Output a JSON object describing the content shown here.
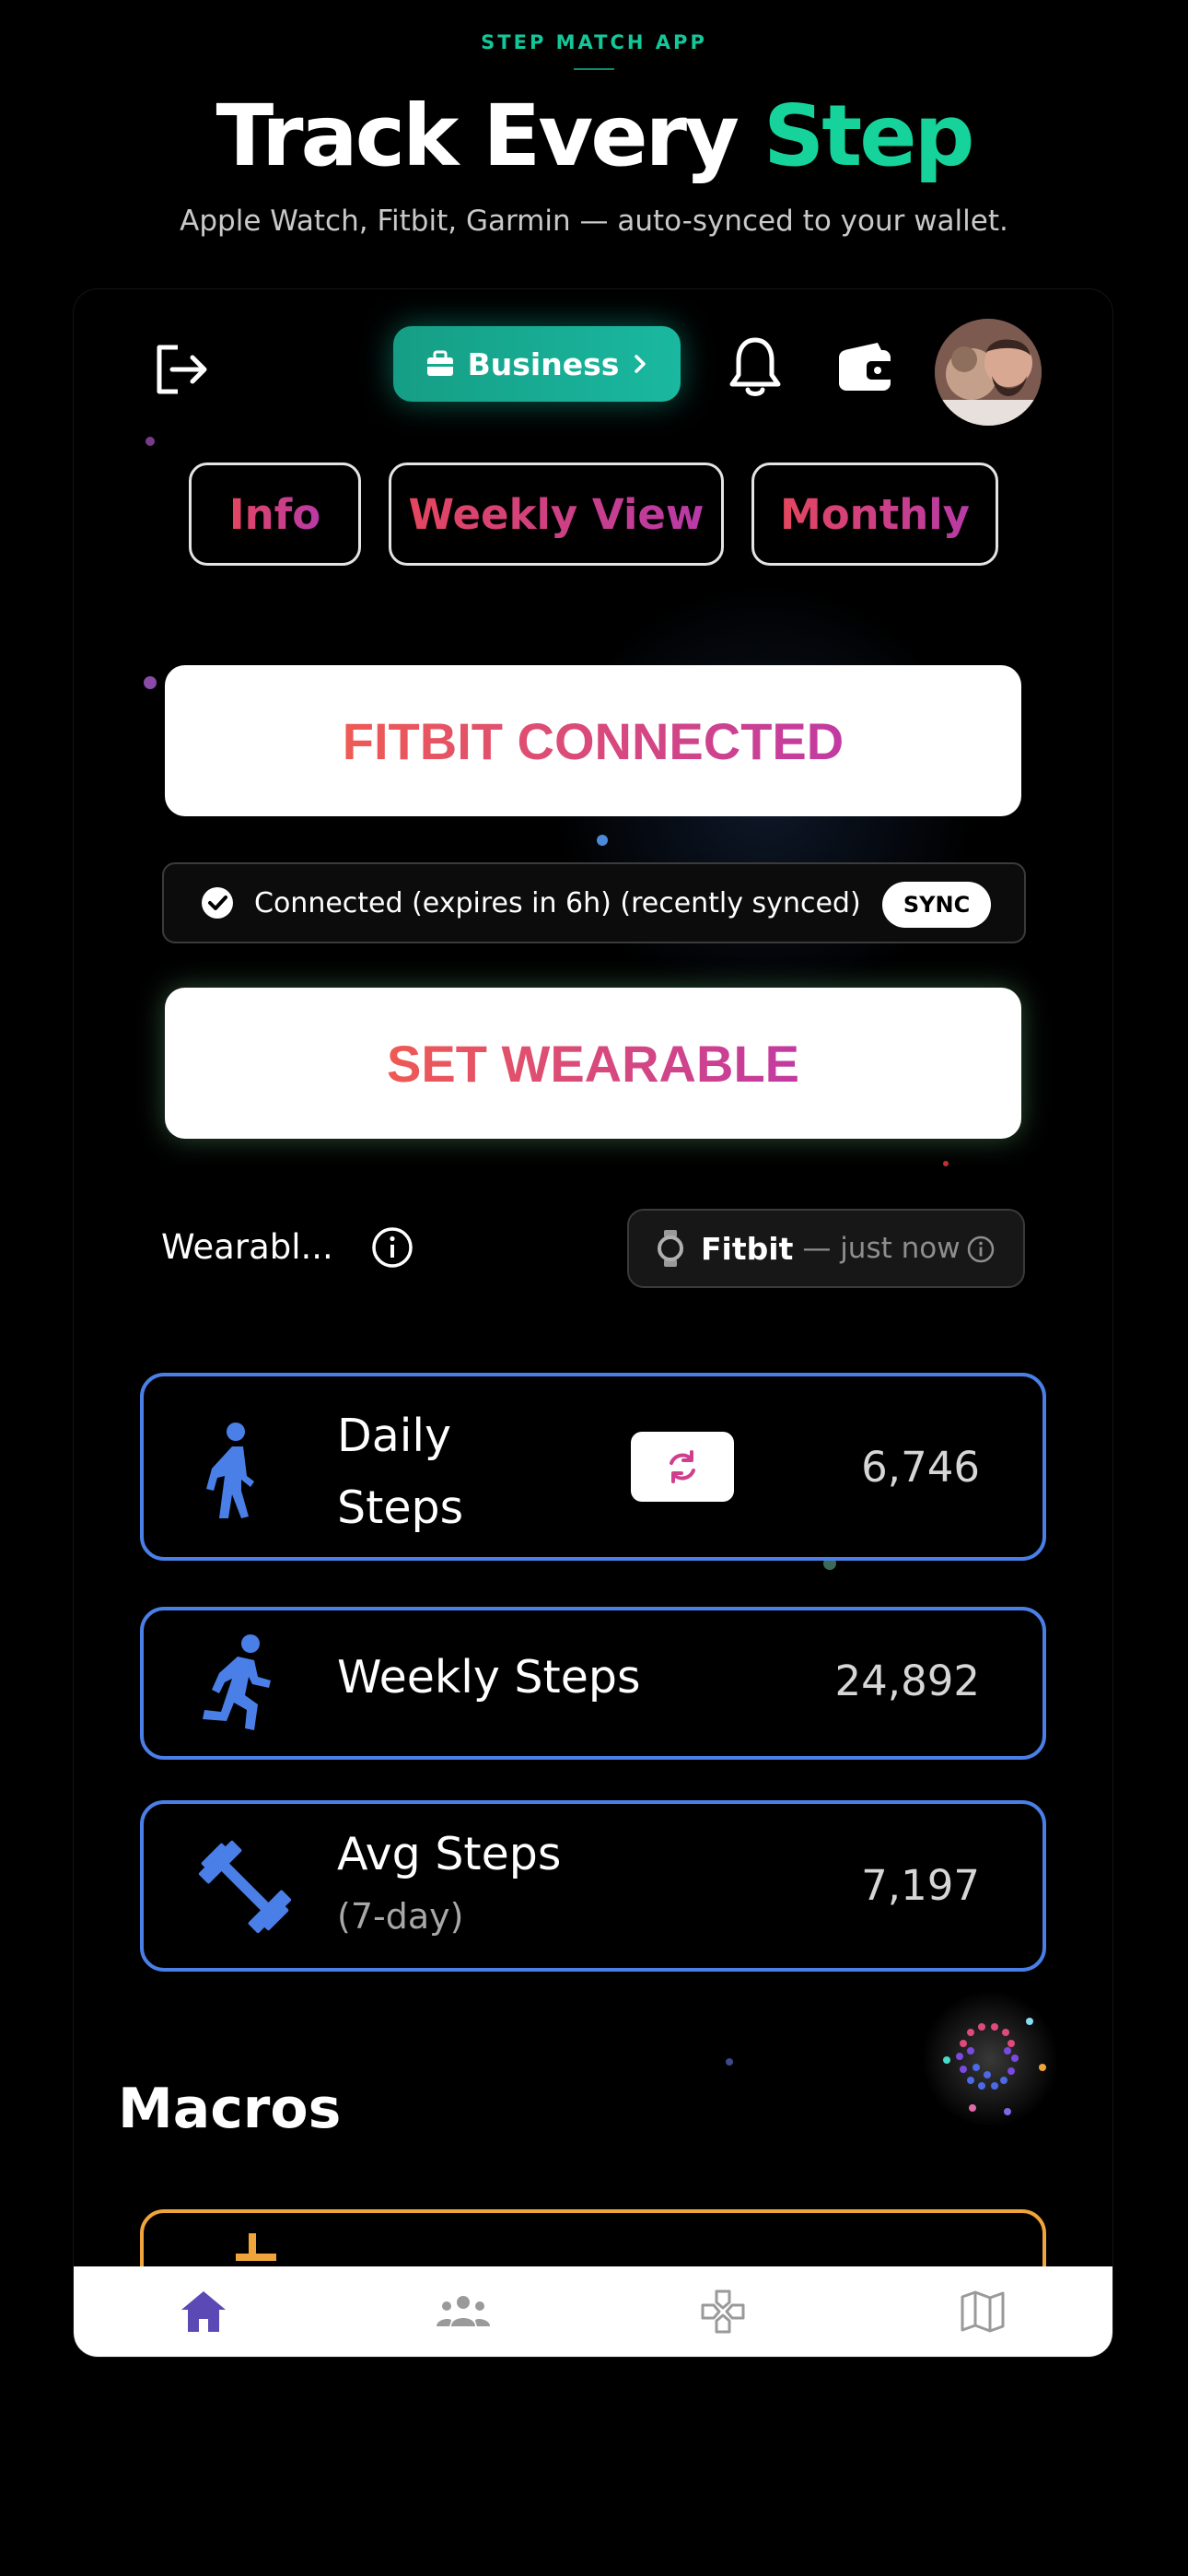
{
  "promo": {
    "eyebrow": "STEP MATCH APP",
    "headline_main": "Track Every ",
    "headline_accent": "Step",
    "subline": "Apple Watch, Fitbit, Garmin — auto-synced to your wallet."
  },
  "header": {
    "business_label": "Business",
    "icons": [
      "logout-icon",
      "briefcase-icon",
      "chevron-right-icon",
      "bell-icon",
      "wallet-icon",
      "avatar"
    ]
  },
  "tabs": [
    {
      "label": "Info"
    },
    {
      "label": "Weekly View"
    },
    {
      "label": "Monthly"
    }
  ],
  "connection": {
    "connected_label": "FITBIT CONNECTED",
    "status_text": "Connected (expires in 6h) (recently synced)",
    "sync_label": "SYNC",
    "set_wearable_label": "SET WEARABLE"
  },
  "wearable": {
    "label": "Wearabl...",
    "device": "Fitbit",
    "last_sync": "— just now"
  },
  "stats": [
    {
      "title": "Daily Steps",
      "title_line1": "Daily",
      "title_line2": "Steps",
      "value": "6,746",
      "icon": "walking-icon"
    },
    {
      "title": "Weekly Steps",
      "value": "24,892",
      "icon": "running-icon"
    },
    {
      "title": "Avg Steps",
      "subtitle": "(7-day)",
      "value": "7,197",
      "icon": "dumbbell-icon"
    }
  ],
  "macros": {
    "title": "Macros"
  },
  "bottom_nav": [
    {
      "name": "home",
      "icon": "home-icon",
      "active": true
    },
    {
      "name": "people",
      "icon": "people-icon",
      "active": false
    },
    {
      "name": "games",
      "icon": "gamepad-icon",
      "active": false
    },
    {
      "name": "map",
      "icon": "map-icon",
      "active": false
    }
  ],
  "colors": {
    "accent_green": "#16d39b",
    "business_teal": "#1ab8a0",
    "card_border_blue": "#4a7fe8",
    "stat_icon_blue": "#4a7fe8",
    "macro_border_orange": "#f0a43c",
    "gradient_start": "#ef5a54",
    "gradient_end": "#c23aa2",
    "nav_active": "#5b4ab5"
  }
}
